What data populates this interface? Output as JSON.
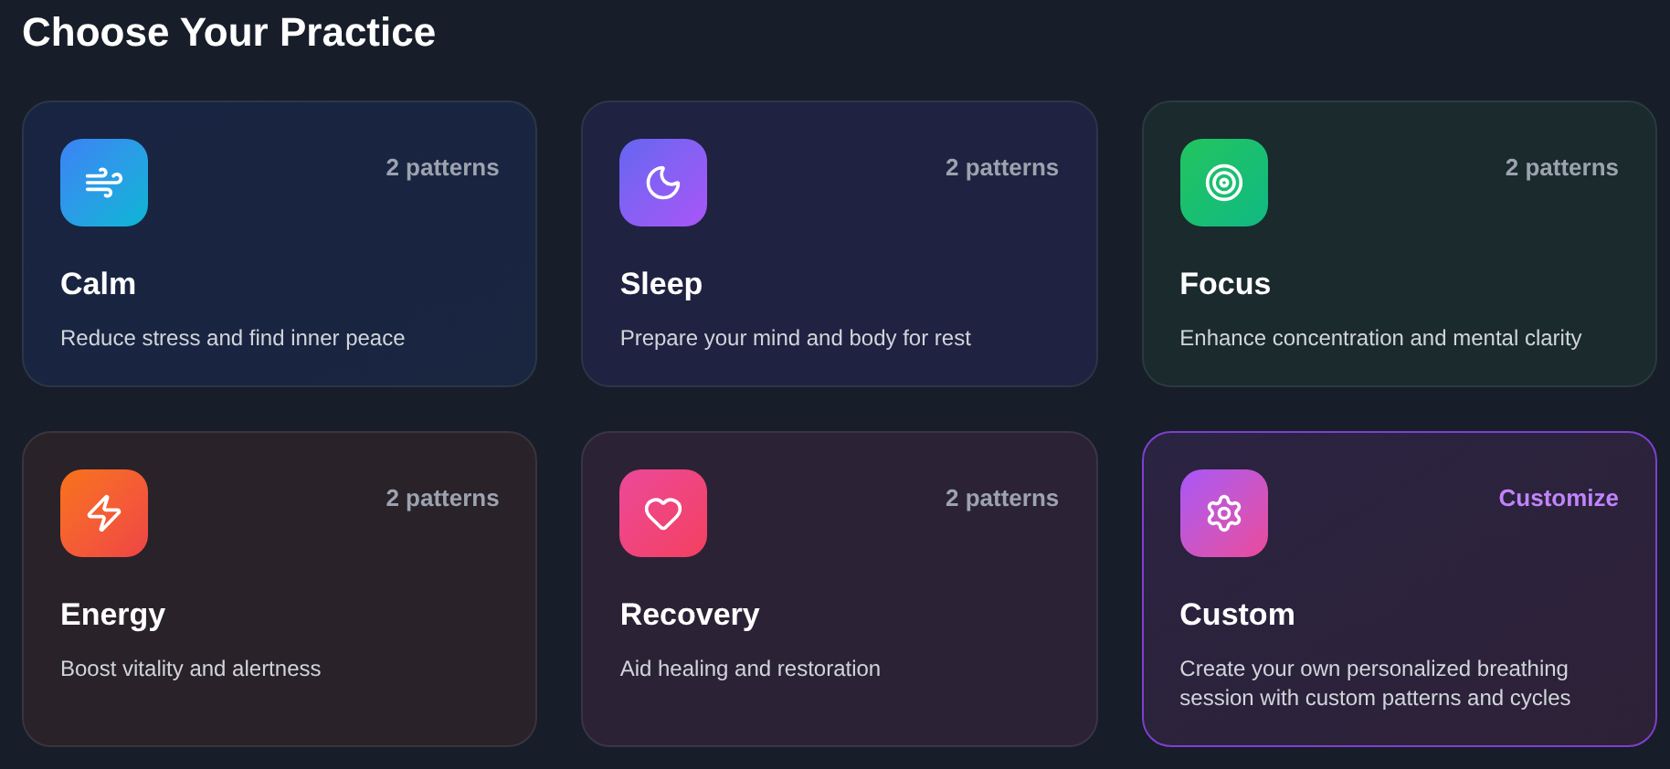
{
  "heading": "Choose Your Practice",
  "practices": [
    {
      "kind": "calm",
      "title": "Calm",
      "meta": "2 patterns",
      "description": "Reduce stress and find inner peace"
    },
    {
      "kind": "sleep",
      "title": "Sleep",
      "meta": "2 patterns",
      "description": "Prepare your mind and body for rest"
    },
    {
      "kind": "focus",
      "title": "Focus",
      "meta": "2 patterns",
      "description": "Enhance concentration and mental clarity"
    },
    {
      "kind": "energy",
      "title": "Energy",
      "meta": "2 patterns",
      "description": "Boost vitality and alertness"
    },
    {
      "kind": "recovery",
      "title": "Recovery",
      "meta": "2 patterns",
      "description": "Aid healing and restoration"
    },
    {
      "kind": "custom",
      "title": "Custom",
      "meta": "Customize",
      "description": "Create your own personalized breathing session with custom patterns and cycles"
    }
  ]
}
